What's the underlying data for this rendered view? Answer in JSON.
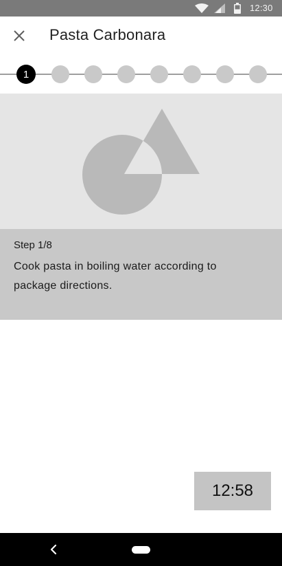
{
  "status_bar": {
    "time": "12:30",
    "icons": [
      "wifi-icon",
      "signal-icon",
      "battery-icon"
    ]
  },
  "app_bar": {
    "close_icon": "close-icon",
    "title": "Pasta Carbonara"
  },
  "stepper": {
    "total_steps": 8,
    "current_step": 1,
    "active_label": "1"
  },
  "media": {
    "placeholder_icon": "image-placeholder-icon"
  },
  "step": {
    "label": "Step 1/8",
    "text": "Cook pasta in boiling water according to package directions."
  },
  "timer": {
    "value": "12:58"
  },
  "nav_bar": {
    "back_icon": "back-icon",
    "home_icon": "home-pill-icon"
  },
  "colors": {
    "status_bar_bg": "#7a7a7a",
    "media_bg": "#e5e5e5",
    "step_info_bg": "#c8c8c8",
    "timer_bg": "#c4c4c4",
    "dot_inactive": "#c9c9c9",
    "dot_active": "#000000",
    "nav_bar_bg": "#000000"
  }
}
